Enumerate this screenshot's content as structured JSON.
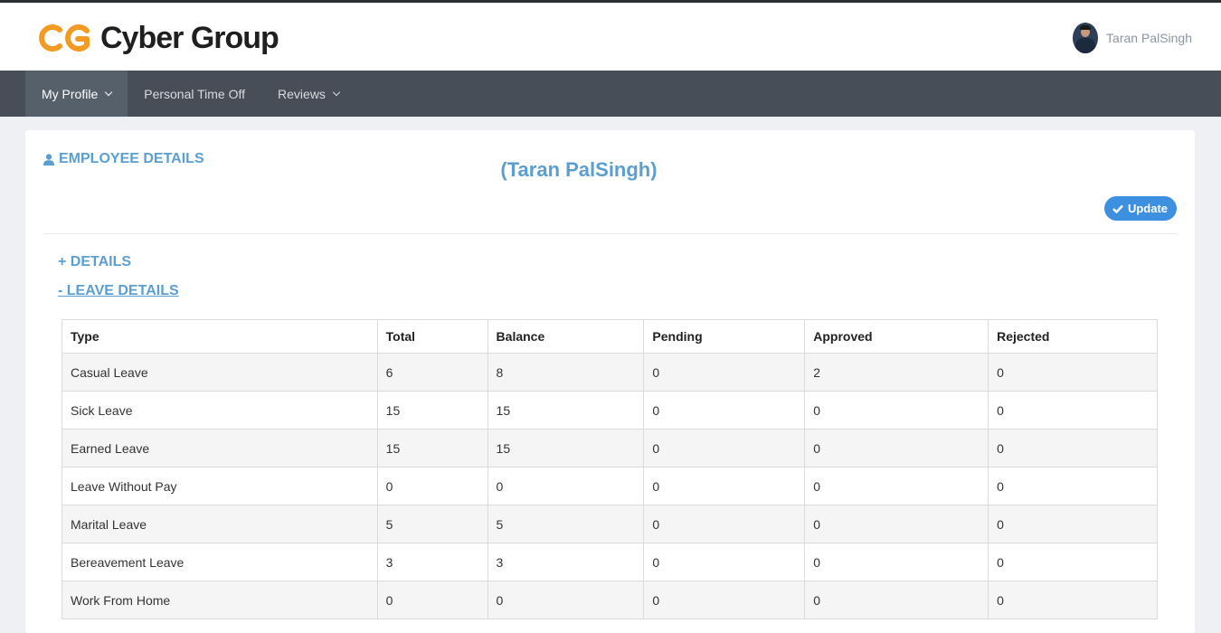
{
  "brand": {
    "name": "Cyber Group",
    "accent": "#f39a23"
  },
  "user": {
    "name": "Taran PalSingh"
  },
  "nav": {
    "items": [
      {
        "label": "My Profile",
        "active": true,
        "dropdown": true
      },
      {
        "label": "Personal Time Off",
        "active": false,
        "dropdown": false
      },
      {
        "label": "Reviews",
        "active": false,
        "dropdown": true
      }
    ]
  },
  "panel": {
    "section_title": "EMPLOYEE DETAILS",
    "employee_name": "(Taran PalSingh)",
    "update_label": "Update",
    "details_link": "+ DETAILS",
    "leave_link": "- LEAVE DETAILS"
  },
  "leave_table": {
    "headers": [
      "Type",
      "Total",
      "Balance",
      "Pending",
      "Approved",
      "Rejected"
    ],
    "rows": [
      [
        "Casual Leave",
        "6",
        "8",
        "0",
        "2",
        "0"
      ],
      [
        "Sick Leave",
        "15",
        "15",
        "0",
        "0",
        "0"
      ],
      [
        "Earned Leave",
        "15",
        "15",
        "0",
        "0",
        "0"
      ],
      [
        "Leave Without Pay",
        "0",
        "0",
        "0",
        "0",
        "0"
      ],
      [
        "Marital Leave",
        "5",
        "5",
        "0",
        "0",
        "0"
      ],
      [
        "Bereavement Leave",
        "3",
        "3",
        "0",
        "0",
        "0"
      ],
      [
        "Work From Home",
        "0",
        "0",
        "0",
        "0",
        "0"
      ]
    ]
  },
  "colors": {
    "link": "#5b9fd0",
    "nav_bg": "#474e58",
    "button": "#3d8fe0"
  }
}
